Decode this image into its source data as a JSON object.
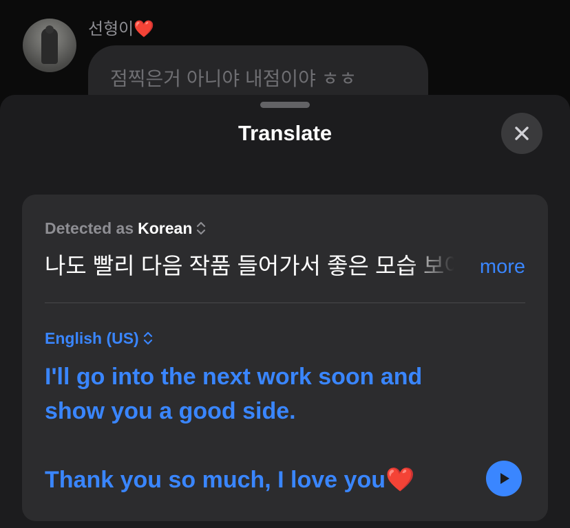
{
  "background_chat": {
    "sender_name": "선형이",
    "sender_heart": "❤️",
    "message_text": "점찍은거 아니야 내점이야 ㅎㅎ"
  },
  "sheet": {
    "title": "Translate",
    "close_icon": "xmark-icon"
  },
  "source": {
    "detected_label": "Detected as",
    "language": "Korean",
    "text": "나도 빨리 다음 작품 들어가서 좋은 모습 보여줄게",
    "more_label": "more"
  },
  "target": {
    "language": "English (US)",
    "line1": "I'll go into the next work soon and show you a good side.",
    "line2": "Thank you so much, I love you❤️",
    "play_icon": "play-icon"
  },
  "colors": {
    "accent": "#3a86ff",
    "sheet_bg": "#1c1c1e",
    "card_bg": "#2c2c2e"
  }
}
